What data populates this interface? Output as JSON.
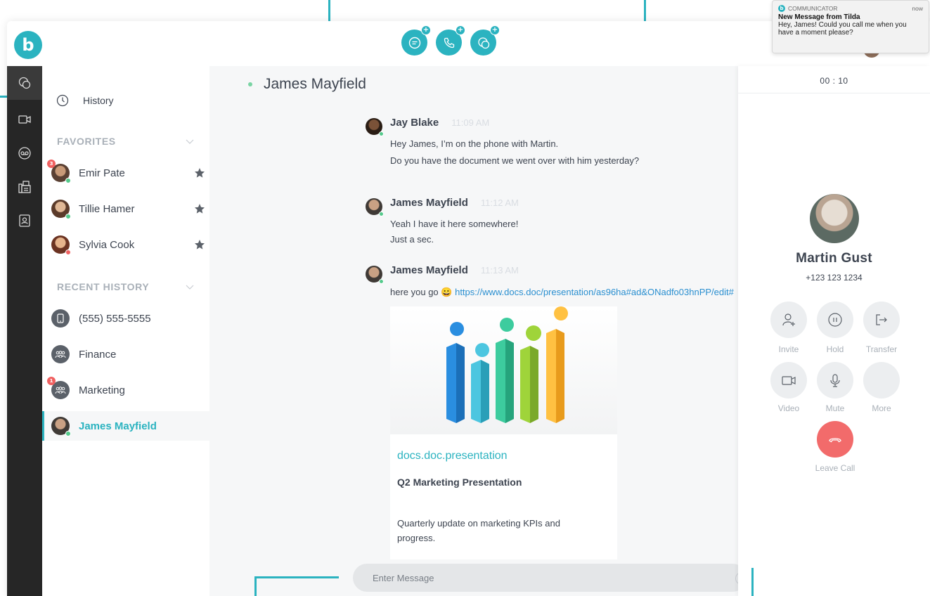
{
  "colors": {
    "accent": "#2bb3c0",
    "rail": "#262626",
    "online": "#54c98b",
    "away": "#f06060",
    "leave_call": "#f26b6b"
  },
  "app": {
    "logo_letter": "b",
    "top_actions": [
      {
        "name": "new-chat-button",
        "icon": "chat-plus-icon"
      },
      {
        "name": "new-call-button",
        "icon": "phone-plus-icon"
      },
      {
        "name": "new-group-chat-button",
        "icon": "group-chat-plus-icon"
      }
    ]
  },
  "rail": {
    "items": [
      {
        "icon": "chat-icon",
        "active": true
      },
      {
        "icon": "video-icon",
        "active": false
      },
      {
        "icon": "voicemail-icon",
        "active": false
      },
      {
        "icon": "fax-icon",
        "active": false
      },
      {
        "icon": "contacts-icon",
        "active": false
      }
    ]
  },
  "sidebar": {
    "history_label": "History",
    "favorites_label": "FAVORITES",
    "recent_label": "RECENT HISTORY",
    "favorites": [
      {
        "name": "Emir Pate",
        "badge": "3",
        "status": "online"
      },
      {
        "name": "Tillie Hamer",
        "badge": "",
        "status": "online"
      },
      {
        "name": "Sylvia Cook",
        "badge": "",
        "status": "away"
      }
    ],
    "recent": [
      {
        "name": "(555) 555-5555",
        "type": "phone",
        "badge": ""
      },
      {
        "name": "Finance",
        "type": "group",
        "badge": ""
      },
      {
        "name": "Marketing",
        "type": "group",
        "badge": "1"
      },
      {
        "name": "James Mayfield",
        "type": "person",
        "badge": "",
        "active": true
      }
    ]
  },
  "chat": {
    "title": "James Mayfield",
    "messages": [
      {
        "sender": "Jay Blake",
        "time": "11:09 AM",
        "lines": [
          "Hey James, I’m on the phone with Martin.",
          "Do you have the document we went over with him yesterday?"
        ]
      },
      {
        "sender": "James Mayfield",
        "time": "11:12 AM",
        "lines": [
          "Yeah I have it here somewhere!",
          "Just a sec."
        ]
      },
      {
        "sender": "James Mayfield",
        "time": "11:13 AM",
        "text": "here you go 😀",
        "link": "https://www.docs.doc/presentation/as96ha#ad&ONadfo03hnPP/edit#"
      }
    ],
    "preview": {
      "domain": "docs.doc.presentation",
      "title": "Q2 Marketing Presentation",
      "description": "Quarterly update on marketing KPIs and progress."
    },
    "composer_placeholder": "Enter Message"
  },
  "call": {
    "timer": "00 : 10",
    "contact_name": "Martin Gust",
    "contact_number": "+123 123 1234",
    "buttons": [
      {
        "label": "Invite",
        "icon": "add-user-icon"
      },
      {
        "label": "Hold",
        "icon": "pause-icon"
      },
      {
        "label": "Transfer",
        "icon": "transfer-icon"
      },
      {
        "label": "Video",
        "icon": "video-icon"
      },
      {
        "label": "Mute",
        "icon": "microphone-icon"
      },
      {
        "label": "More",
        "icon": ""
      }
    ],
    "leave_label": "Leave Call"
  },
  "notification": {
    "app": "COMMUNICATOR",
    "when": "now",
    "title": "New Message from Tilda",
    "body": "Hey, James! Could you call me when you have a moment please?"
  }
}
